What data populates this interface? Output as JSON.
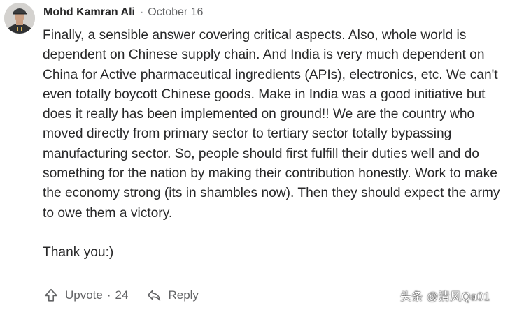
{
  "comment": {
    "author": "Mohd Kamran Ali",
    "separator": "·",
    "date": "October 16",
    "paragraphs": [
      "Finally, a sensible answer covering critical aspects. Also, whole world is dependent on Chinese supply chain. And India is very much dependent on China for Active pharmaceutical ingredients (APIs), electronics, etc. We can't even totally boycott Chinese goods. Make in India was a good initiative but does it really has been implemented on ground!! We are the country who moved directly from primary sector to tertiary sector totally bypassing manufacturing sector. So, people should first fulfill their duties well and do something for the nation by making their contribution honestly. Work to make the economy strong (its in shambles now). Then they should expect the army to owe them a victory.",
      "Thank you:)"
    ]
  },
  "actions": {
    "upvote_label": "Upvote",
    "dot": "·",
    "upvote_count": "24",
    "reply_label": "Reply"
  },
  "watermark": {
    "text": "头条 @清风Qa01"
  },
  "icons": {
    "upvote": "upvote-arrow-icon",
    "reply": "reply-arrow-icon"
  }
}
